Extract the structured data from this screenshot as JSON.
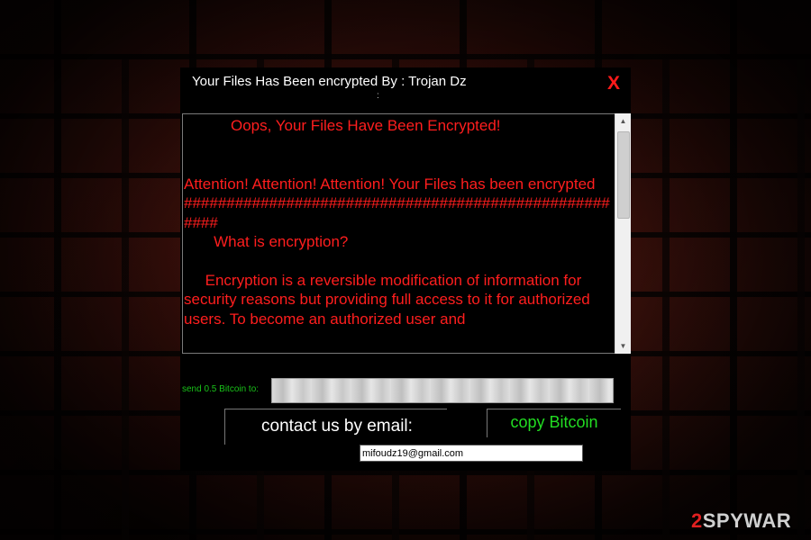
{
  "window": {
    "title": "Your Files Has Been encrypted By : Trojan Dz",
    "title_dot": ":",
    "close_label": "X"
  },
  "message": {
    "heading": "           Oops, Your Files Have Been Encrypted!",
    "line1": "Attention! Attention! Attention! Your Files has been encrypted",
    "hashes": "######################################################",
    "question": "       What is encryption?",
    "para": "     Encryption is a reversible modification of information for security reasons but providing full access to it for authorized users. To become an authorized user and"
  },
  "payment": {
    "send_label": "send 0.5 Bitcoin to:",
    "bitcoin_address": ""
  },
  "contact": {
    "label": "contact us by email:",
    "email": "mifoudz19@gmail.com"
  },
  "buttons": {
    "copy_bitcoin": "copy Bitcoin"
  },
  "watermark": {
    "prefix": "2",
    "text": "SPYWAR"
  },
  "colors": {
    "message_text": "#ff1e1e",
    "accent_green": "#22dd22",
    "close_red": "#ff1a1a"
  }
}
